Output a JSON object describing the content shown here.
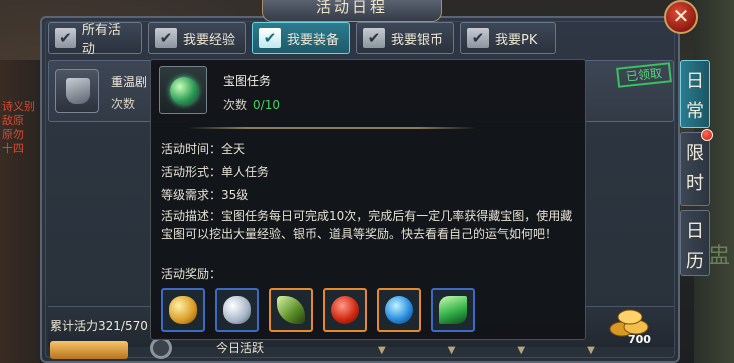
{
  "window": {
    "title": "活动日程",
    "close_label": "✕"
  },
  "tabs": [
    {
      "label": "所有活动",
      "active": false
    },
    {
      "label": "我要经验",
      "active": false
    },
    {
      "label": "我要装备",
      "active": true
    },
    {
      "label": "我要银币",
      "active": false
    },
    {
      "label": "我要PK",
      "active": false
    }
  ],
  "side_tabs": [
    {
      "label": "日\n常",
      "active": true,
      "badge": false
    },
    {
      "label": "限\n时",
      "active": false,
      "badge": true
    },
    {
      "label": "日\n历",
      "active": false,
      "badge": false
    }
  ],
  "list_row": {
    "name": "重温剧",
    "count_label": "次数",
    "stamp": "已领取"
  },
  "popup": {
    "name": "宝图任务",
    "count_label": "次数",
    "count_value": "0/10",
    "time": "活动时间：全天",
    "form": "活动形式：单人任务",
    "level": "等级需求：35级",
    "description": "活动描述：宝图任务每日可完成10次，完成后有一定几率获得藏宝图，使用藏宝图可以挖出大量经验、银币、道具等奖励。快去看看自己的运气如何吧！",
    "reward_label": "活动奖励：",
    "rewards": [
      {
        "icon": "gold-coins-icon",
        "frame": "blue"
      },
      {
        "icon": "silver-coins-icon",
        "frame": "blue"
      },
      {
        "icon": "jade-claw-icon",
        "frame": "orange"
      },
      {
        "icon": "red-orb-icon",
        "frame": "orange"
      },
      {
        "icon": "blue-swirl-icon",
        "frame": "orange"
      },
      {
        "icon": "green-gem-icon",
        "frame": "blue"
      }
    ]
  },
  "footer": {
    "total_activity": "累计活力321/570",
    "today_label": "今日活跃",
    "coin_value": "700"
  },
  "background": {
    "left_text": "诗义别\n\n敌原\n\n\n十四\n\n"
  },
  "colors": {
    "accent_active": "#2b7c8f",
    "progress_green": "#46d05f",
    "gold": "#d99a24",
    "close_red": "#c3160a"
  }
}
